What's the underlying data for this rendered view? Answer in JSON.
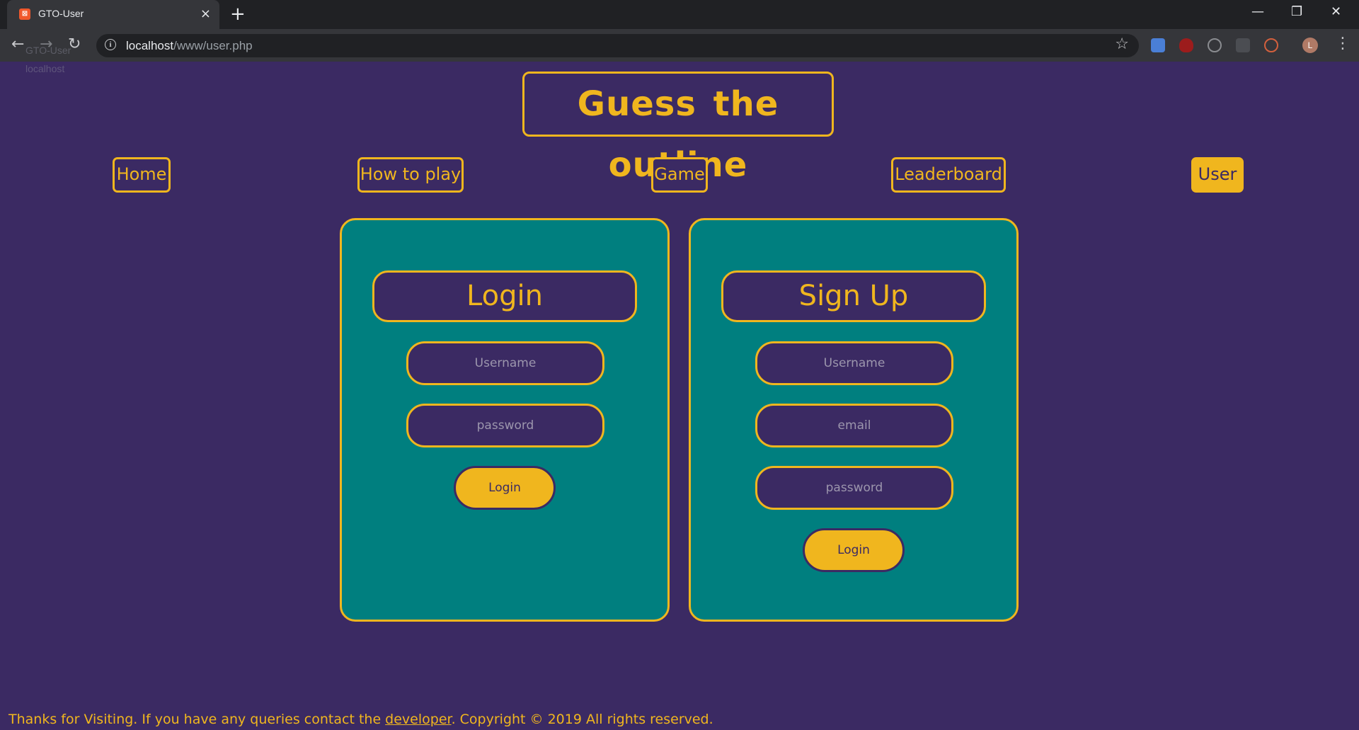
{
  "browser": {
    "tab_title": "GTO-User",
    "tab_favicon": "xampp-icon",
    "tab_close": "×",
    "new_tab": "+",
    "url_host": "localhost",
    "url_path": "/www/user.php",
    "window_minimize": "—",
    "window_restore": "❐",
    "window_close": "✕",
    "back": "←",
    "forward": "→",
    "reload": "↻",
    "star": "☆",
    "avatar_initial": "L",
    "menu": "⋮",
    "ghost_title": "GTO-User",
    "ghost_host": "localhost"
  },
  "site": {
    "title": "Guess the outline"
  },
  "nav": {
    "home": "Home",
    "how_to_play": "How to play",
    "game": "Game",
    "leaderboard": "Leaderboard",
    "user": "User",
    "active": "User"
  },
  "login": {
    "heading": "Login",
    "username_placeholder": "Username",
    "password_placeholder": "password",
    "submit": "Login"
  },
  "signup": {
    "heading": "Sign Up",
    "username_placeholder": "Username",
    "email_placeholder": "email",
    "password_placeholder": "password",
    "submit": "Login"
  },
  "footer": {
    "text_before": "Thanks for Visiting. If you have any queries contact the ",
    "link": "developer",
    "text_after": ". Copyright © 2019 All rights reserved."
  },
  "colors": {
    "background": "#3b2a63",
    "accent": "#f0b61e",
    "panel": "#007f7f"
  }
}
